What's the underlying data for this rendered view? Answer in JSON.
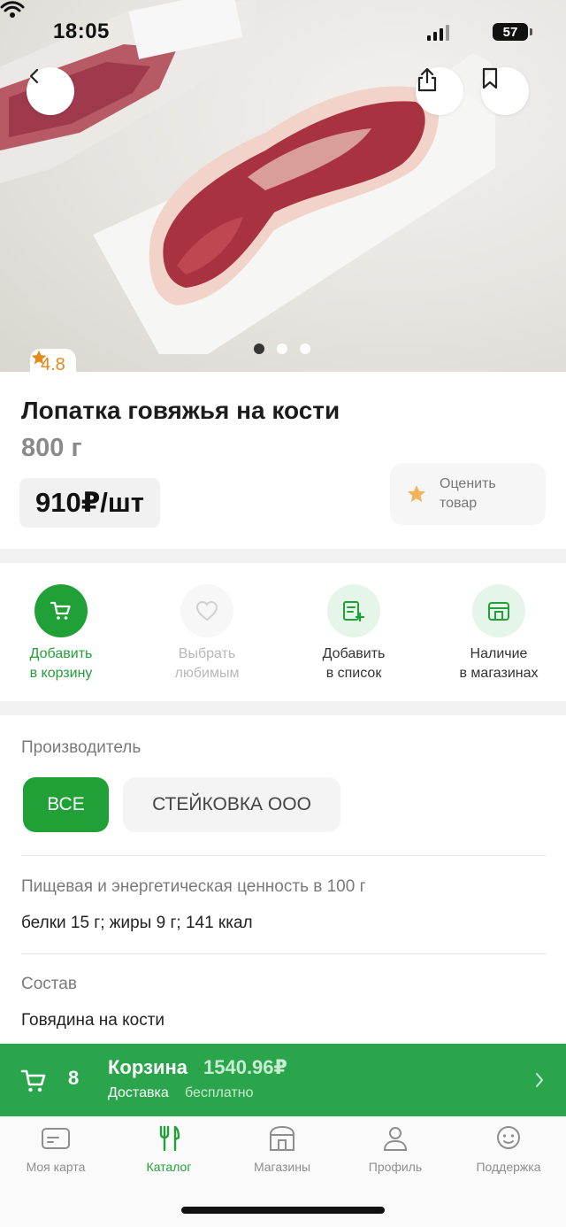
{
  "status": {
    "time": "18:05",
    "battery": "57"
  },
  "product": {
    "rating": "4.8",
    "title": "Лопатка говяжья на кости",
    "weight": "800 г",
    "price": "910₽/шт",
    "rate_line1": "Оценить",
    "rate_line2": "товар"
  },
  "actions": [
    {
      "line1": "Добавить",
      "line2": "в корзину",
      "icon": "cart-icon"
    },
    {
      "line1": "Выбрать",
      "line2": "любимым",
      "icon": "heart-icon"
    },
    {
      "line1": "Добавить",
      "line2": "в список",
      "icon": "list-add-icon"
    },
    {
      "line1": "Наличие",
      "line2": "в магазинах",
      "icon": "store-icon"
    }
  ],
  "details": {
    "manufacturer_label": "Производитель",
    "chips": [
      "ВСЕ",
      "СТЕЙКОВКА ООО"
    ],
    "nutrition_label": "Пищевая и энергетическая ценность в 100 г",
    "nutrition_value": "белки 15 г; жиры 9 г; 141 ккал",
    "composition_label": "Состав",
    "composition_value": "Говядина на кости"
  },
  "cart": {
    "count": "8",
    "title": "Корзина",
    "total": "1540.96₽",
    "delivery_label": "Доставка",
    "delivery_value": "бесплатно"
  },
  "tabs": [
    {
      "label": "Моя карта",
      "icon": "card-icon"
    },
    {
      "label": "Каталог",
      "icon": "fork-knife-icon"
    },
    {
      "label": "Магазины",
      "icon": "shop-icon"
    },
    {
      "label": "Профиль",
      "icon": "profile-icon"
    },
    {
      "label": "Поддержка",
      "icon": "support-icon"
    }
  ],
  "colors": {
    "brand": "#21a038",
    "cart_bar": "#2aa54c",
    "rating": "#e38a17"
  }
}
